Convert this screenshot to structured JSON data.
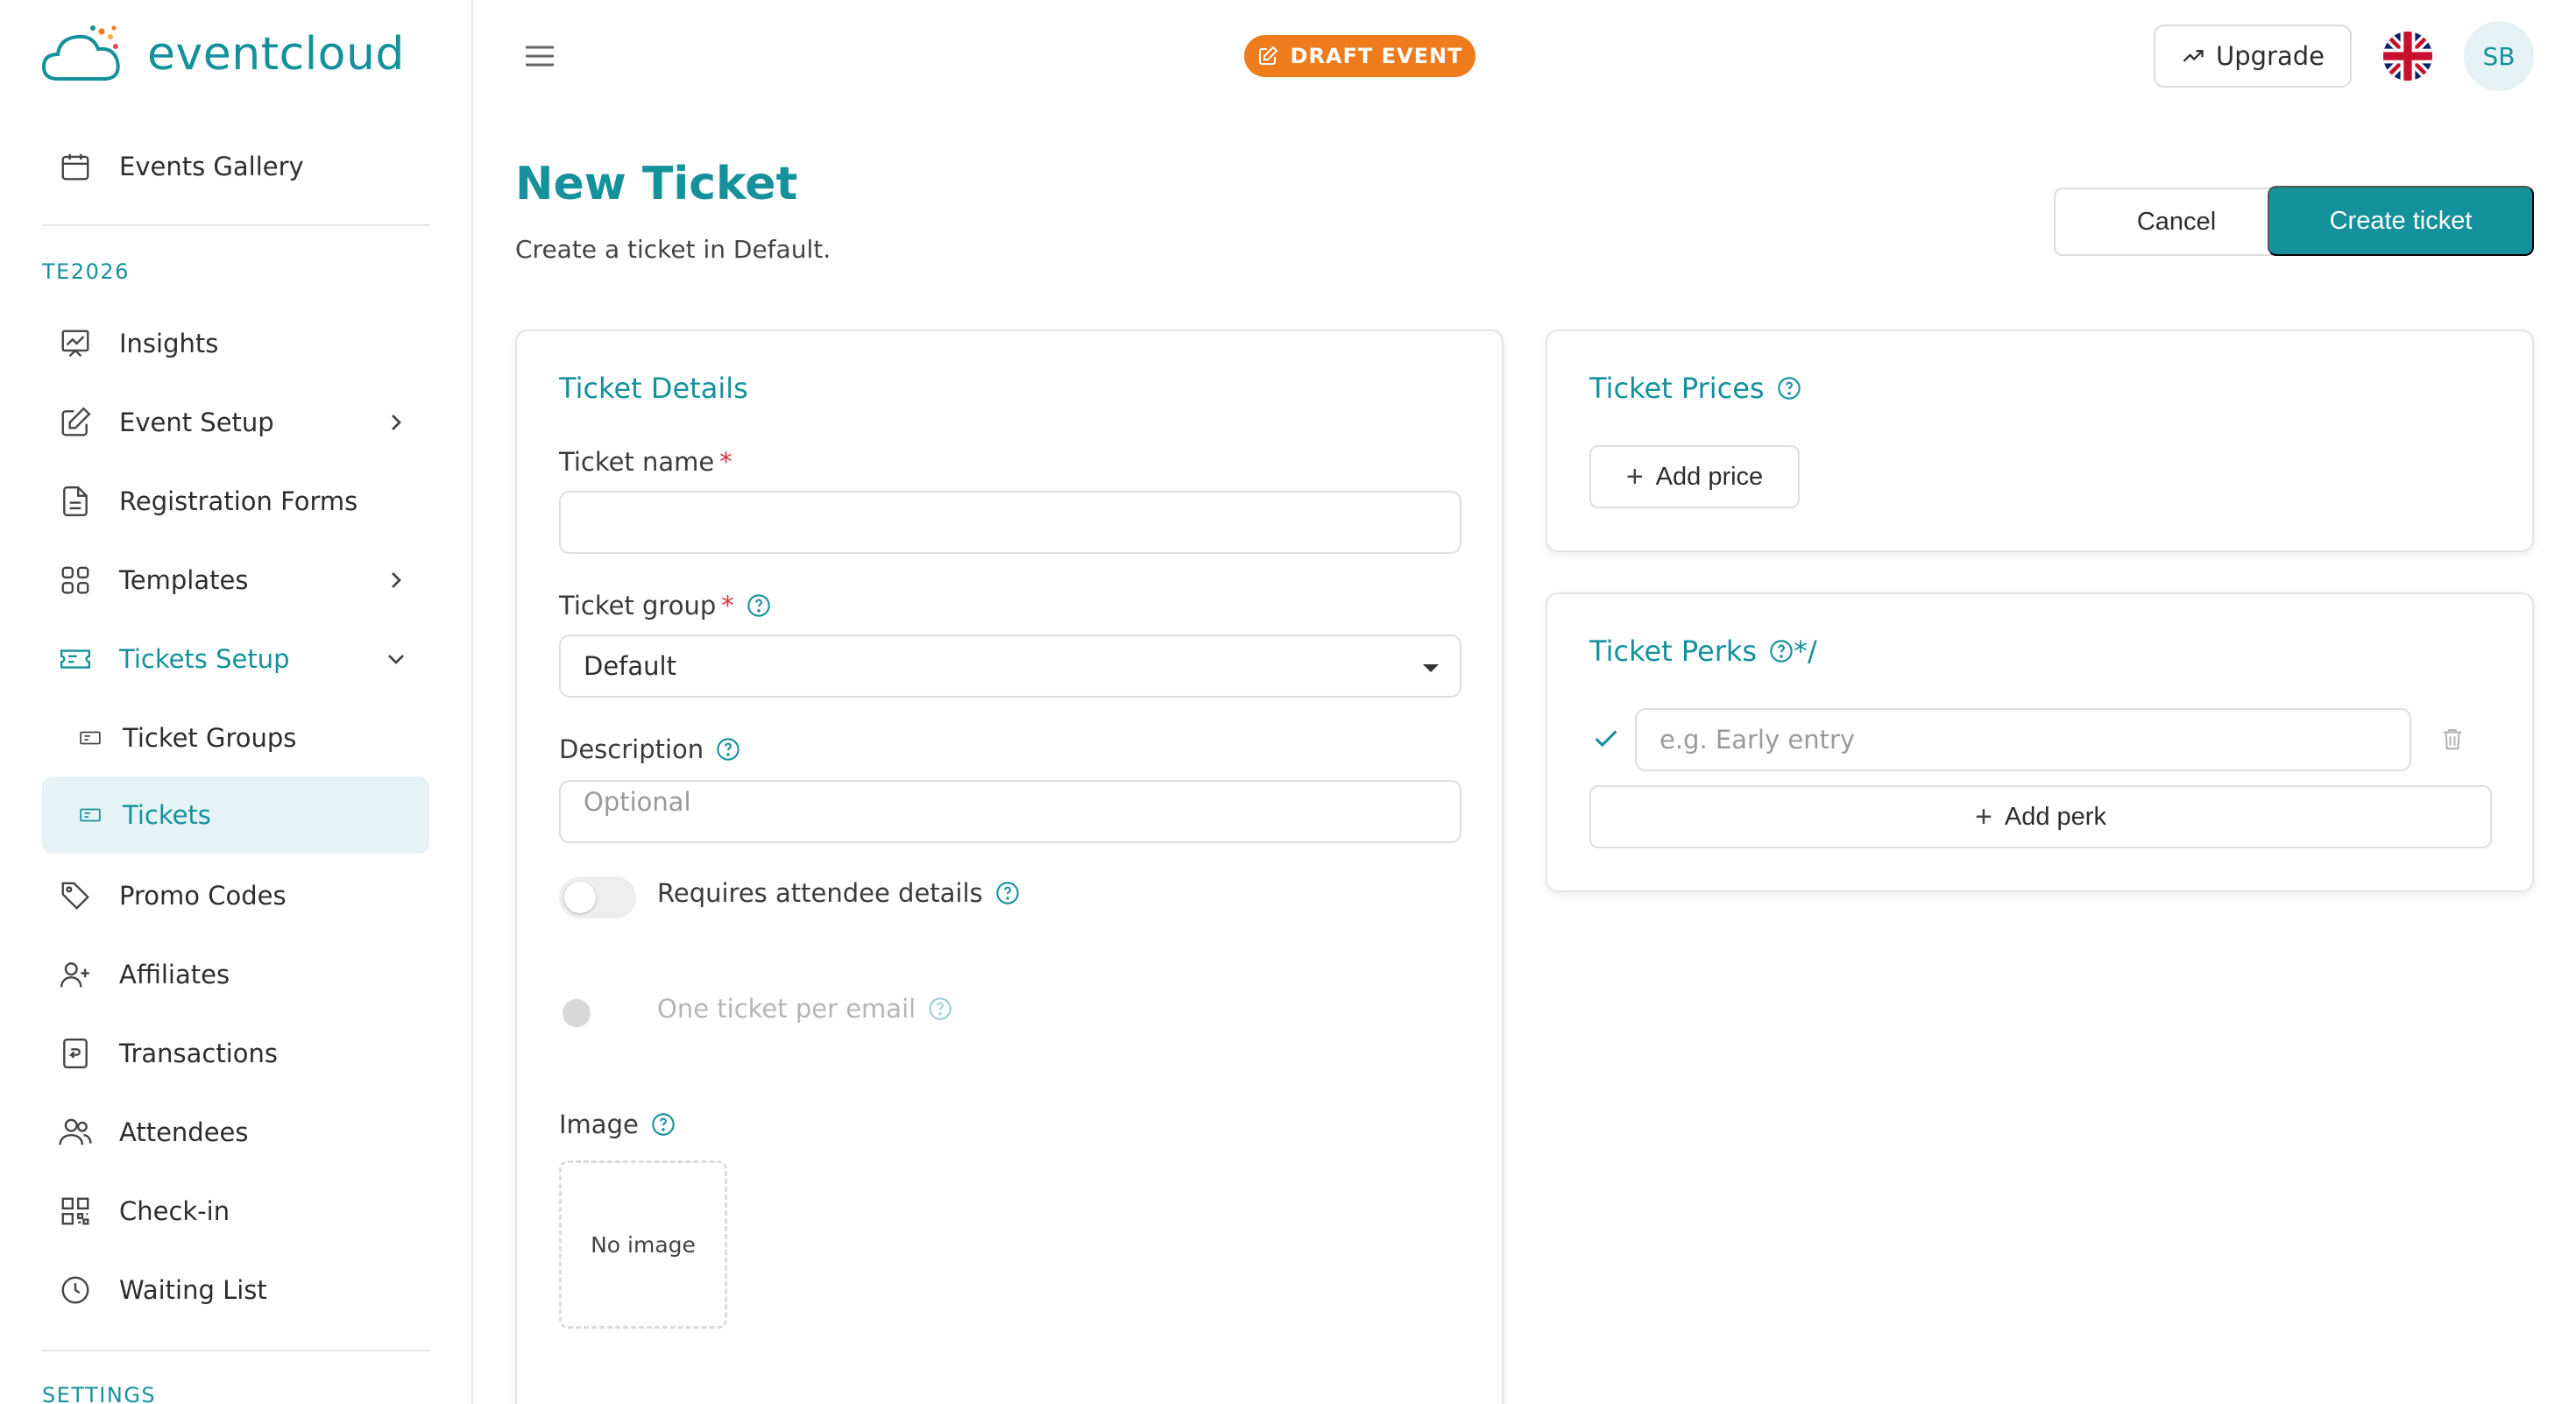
{
  "brand": {
    "name": "eventcloud",
    "accent": "#14919b",
    "orange": "#ee7b1c"
  },
  "sidebar": {
    "top_item": {
      "label": "Events Gallery",
      "icon": "calendar-icon"
    },
    "section_event": "TE2026",
    "items": [
      {
        "label": "Insights",
        "icon": "chart-board-icon"
      },
      {
        "label": "Event Setup",
        "icon": "edit-icon",
        "chevron": "right"
      },
      {
        "label": "Registration Forms",
        "icon": "document-icon"
      },
      {
        "label": "Templates",
        "icon": "grid-icon",
        "chevron": "right"
      },
      {
        "label": "Tickets Setup",
        "icon": "ticket-icon",
        "chevron": "down",
        "active": true
      },
      {
        "label": "Ticket Groups",
        "icon": "ticket-small-icon",
        "sub": true
      },
      {
        "label": "Tickets",
        "icon": "ticket-small-icon",
        "sub": true,
        "selected": true
      },
      {
        "label": "Promo Codes",
        "icon": "tag-icon"
      },
      {
        "label": "Affiliates",
        "icon": "user-plus-icon"
      },
      {
        "label": "Transactions",
        "icon": "receipt-icon"
      },
      {
        "label": "Attendees",
        "icon": "users-icon"
      },
      {
        "label": "Check-in",
        "icon": "qr-code-icon"
      },
      {
        "label": "Waiting List",
        "icon": "clock-icon"
      }
    ],
    "section_settings": "SETTINGS"
  },
  "header": {
    "badge": "DRAFT EVENT",
    "upgrade_label": "Upgrade",
    "language_icon": "uk-flag-icon",
    "avatar_initials": "SB"
  },
  "page": {
    "title": "New Ticket",
    "subtitle": "Create a ticket in Default.",
    "cancel_label": "Cancel",
    "create_label": "Create ticket"
  },
  "details": {
    "title": "Ticket Details",
    "name_label": "Ticket name",
    "required_mark": "*",
    "name_value": "",
    "group_label": "Ticket group",
    "group_value": "Default",
    "description_label": "Description",
    "description_placeholder": "Optional",
    "attendee_toggle_label": "Requires attendee details",
    "attendee_toggle_on": false,
    "email_toggle_label": "One ticket per email",
    "email_toggle_on": false,
    "image_label": "Image",
    "image_placeholder": "No image"
  },
  "prices": {
    "title": "Ticket Prices",
    "add_label": "Add price"
  },
  "perks": {
    "title": "Ticket Perks",
    "perk_placeholder": "e.g. Early entry",
    "add_label": "Add perk"
  }
}
